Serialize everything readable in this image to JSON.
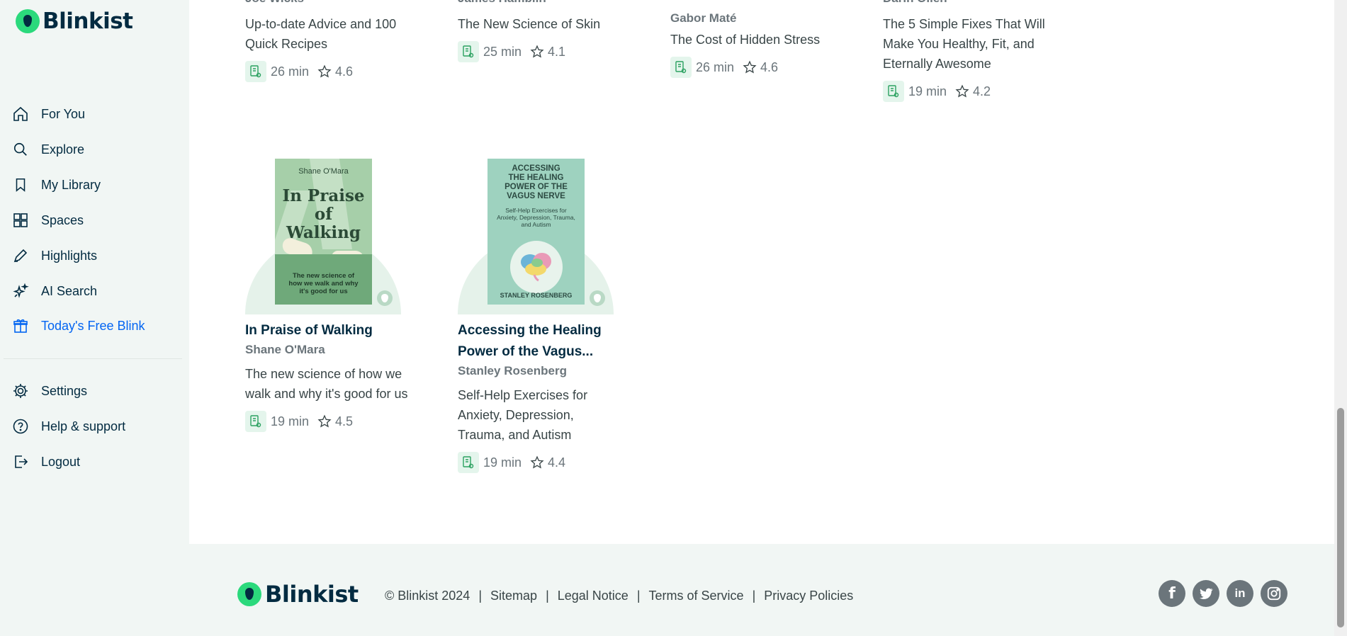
{
  "app": {
    "logo_text": "Blinkist"
  },
  "sidebar": {
    "nav": [
      {
        "label": "For You",
        "icon": "home-icon"
      },
      {
        "label": "Explore",
        "icon": "search-icon"
      },
      {
        "label": "My Library",
        "icon": "bookmark-icon"
      },
      {
        "label": "Spaces",
        "icon": "grid-icon"
      },
      {
        "label": "Highlights",
        "icon": "pen-icon"
      },
      {
        "label": "AI Search",
        "icon": "sparkle-icon"
      },
      {
        "label": "Today's Free Blink",
        "icon": "gift-icon",
        "active": true
      }
    ],
    "bottom": [
      {
        "label": "Settings",
        "icon": "gear-icon"
      },
      {
        "label": "Help & support",
        "icon": "help-icon"
      },
      {
        "label": "Logout",
        "icon": "logout-icon"
      }
    ],
    "active_color": "#0365f2"
  },
  "top_row": [
    {
      "author": "Joe Wicks",
      "subtitle": "Up-to-date Advice and 100 Quick Recipes",
      "duration": "26 min",
      "rating": "4.6"
    },
    {
      "author": "James Hamblin",
      "subtitle": "The New Science of Skin",
      "duration": "25 min",
      "rating": "4.1"
    },
    {
      "author": "Gabor Maté",
      "subtitle": "The Cost of Hidden Stress",
      "duration": "26 min",
      "rating": "4.6"
    },
    {
      "author": "Darin Olien",
      "subtitle": "The 5 Simple Fixes That Will Make You Healthy, Fit, and Eternally Awesome",
      "duration": "19 min",
      "rating": "4.2"
    }
  ],
  "books": [
    {
      "title": "In Praise of Walking",
      "author": "Shane O'Mara",
      "subtitle": "The new science of how we walk and why it's good for us",
      "duration": "19 min",
      "rating": "4.5",
      "cover": {
        "author": "Shane O'Mara",
        "title_line1": "In Praise",
        "title_line2": "of Walking",
        "tagline_line1": "The new science of",
        "tagline_line2": "how we walk and why",
        "tagline_line3": "it's good for us"
      }
    },
    {
      "title_line1": "Accessing the Healing",
      "title_line2": "Power of the Vagus...",
      "author": "Stanley Rosenberg",
      "subtitle": "Self-Help Exercises for Anxiety, Depression, Trauma, and Autism",
      "duration": "19 min",
      "rating": "4.4",
      "cover": {
        "title_line1": "ACCESSING",
        "title_line2": "THE HEALING",
        "title_line3": "POWER OF THE",
        "title_line4": "VAGUS NERVE",
        "sub_line1": "Self-Help Exercises for",
        "sub_line2": "Anxiety, Depression, Trauma,",
        "sub_line3": "and Autism",
        "author": "STANLEY ROSENBERG"
      }
    }
  ],
  "footer": {
    "logo_text": "Blinkist",
    "links": [
      "© Blinkist 2024",
      "Sitemap",
      "Legal Notice",
      "Terms of Service",
      "Privacy Policies"
    ],
    "social": [
      {
        "name": "facebook-icon",
        "glyph": "f"
      },
      {
        "name": "twitter-icon",
        "glyph": "t"
      },
      {
        "name": "linkedin-icon",
        "glyph": "in"
      },
      {
        "name": "instagram-icon",
        "glyph": "◎"
      }
    ]
  }
}
